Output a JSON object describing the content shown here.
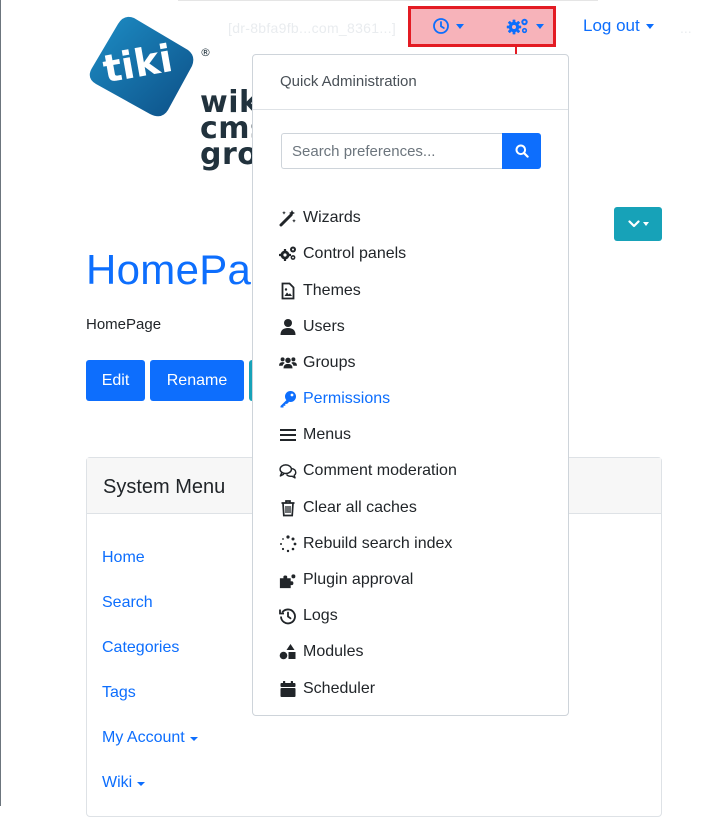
{
  "topnav": {
    "ghost_url": "[dr-8bfa9fb...com_8361...]",
    "ghost_dots": "...",
    "recent_label": "",
    "admin_label": "",
    "logout_label": "Log out"
  },
  "logo": {
    "line1": "wik",
    "line2": "cms",
    "line3": "grou"
  },
  "page": {
    "title": "HomePa",
    "breadcrumb": "HomePage",
    "buttons": [
      "Edit",
      "Rename"
    ]
  },
  "system_menu": {
    "title": "System Menu",
    "items": [
      {
        "label": "Home"
      },
      {
        "label": "Search"
      },
      {
        "label": "Categories"
      },
      {
        "label": "Tags"
      },
      {
        "label": "My Account"
      },
      {
        "label": "Wiki"
      }
    ]
  },
  "quick_admin": {
    "header": "Quick Administration",
    "search_placeholder": "Search preferences...",
    "items": [
      {
        "label": "Wizards",
        "icon": "magic-wand-icon"
      },
      {
        "label": "Control panels",
        "icon": "cogs-icon"
      },
      {
        "label": "Themes",
        "icon": "file-image-icon"
      },
      {
        "label": "Users",
        "icon": "user-icon"
      },
      {
        "label": "Groups",
        "icon": "users-icon"
      },
      {
        "label": "Permissions",
        "icon": "key-icon"
      },
      {
        "label": "Menus",
        "icon": "bars-icon"
      },
      {
        "label": "Comment moderation",
        "icon": "comments-icon"
      },
      {
        "label": "Clear all caches",
        "icon": "trash-icon"
      },
      {
        "label": "Rebuild search index",
        "icon": "spinner-icon"
      },
      {
        "label": "Plugin approval",
        "icon": "puzzle-icon"
      },
      {
        "label": "Logs",
        "icon": "history-icon"
      },
      {
        "label": "Modules",
        "icon": "shapes-icon"
      },
      {
        "label": "Scheduler",
        "icon": "calendar-icon"
      }
    ]
  },
  "colors": {
    "link": "#0d6efd",
    "teal": "#17a2b8",
    "annotation_red": "#e31b23",
    "annotation_fill": "#f7b3ba"
  }
}
